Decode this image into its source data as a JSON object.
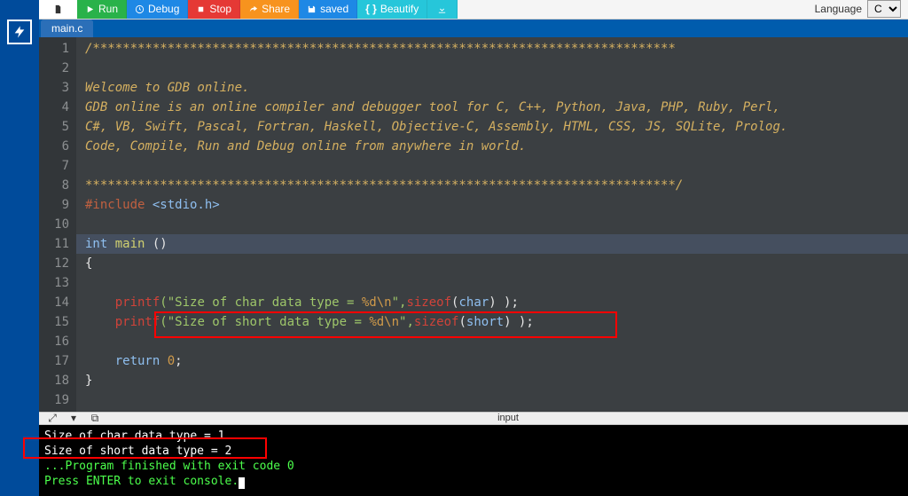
{
  "toolbar": {
    "run_label": "Run",
    "debug_label": "Debug",
    "stop_label": "Stop",
    "share_label": "Share",
    "save_label": "saved",
    "beautify_label": "Beautify"
  },
  "language": {
    "label": "Language",
    "value": "C"
  },
  "tab": {
    "filename": "main.c"
  },
  "code": {
    "l1": "/******************************************************************************",
    "l2": "",
    "l3": "Welcome to GDB online.",
    "l4": "GDB online is an online compiler and debugger tool for C, C++, Python, Java, PHP, Ruby, Perl,",
    "l5": "C#, VB, Swift, Pascal, Fortran, Haskell, Objective-C, Assembly, HTML, CSS, JS, SQLite, Prolog.",
    "l6": "Code, Compile, Run and Debug online from anywhere in world.",
    "l7": "",
    "l8": "*******************************************************************************/",
    "l9pre": "#include ",
    "l9inc": "<stdio.h>",
    "l11a": "int",
    "l11b": " main ",
    "l11c": "()",
    "l12": "{",
    "l14pf": "printf",
    "l14s1": "(\"Size of char data type = ",
    "l14esc": "%d\\n",
    "l14s2": "\",",
    "l14sz": "sizeof",
    "l14p2": "(",
    "l14ty": "char",
    "l14p3": ") );",
    "l15pf": "printf",
    "l15s1": "(\"Size of short data type = ",
    "l15esc": "%d\\n",
    "l15s2": "\",",
    "l15sz": "sizeof",
    "l15p2": "(",
    "l15ty": "short",
    "l15p3": ") );",
    "l17a": "return",
    "l17b": " 0",
    "l17c": ";",
    "l18": "}"
  },
  "gutters": [
    "1",
    "2",
    "3",
    "4",
    "5",
    "6",
    "7",
    "8",
    "9",
    "10",
    "11",
    "12",
    "13",
    "14",
    "15",
    "16",
    "17",
    "18",
    "19"
  ],
  "iopanel": {
    "input_label": "input"
  },
  "terminal": {
    "line1": "Size of char data type = 1",
    "line2": "Size of short data type = 2",
    "line3": "",
    "line4": "...Program finished with exit code 0",
    "line5": "Press ENTER to exit console."
  }
}
